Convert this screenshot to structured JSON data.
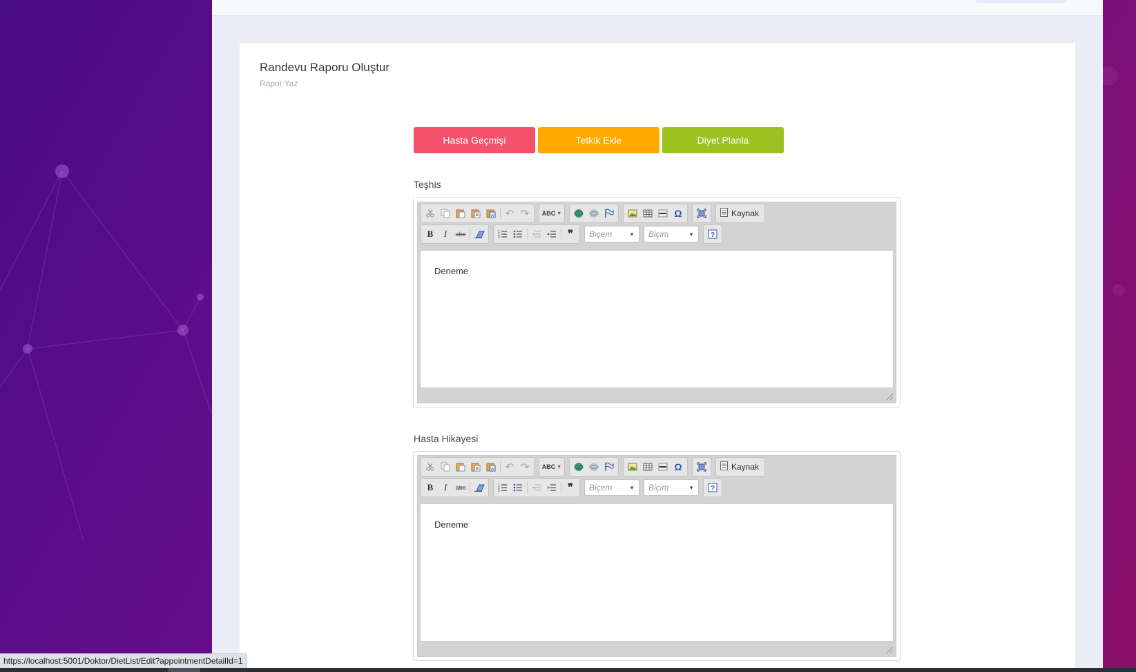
{
  "page": {
    "title": "Randevu Raporu Oluştur",
    "subtitle": "Rapor Yaz"
  },
  "actions": {
    "history_label": "Hasta Geçmişi",
    "test_label": "Tetkik Ekle",
    "diet_label": "Diyet Planla",
    "colors": {
      "history": "#f4516c",
      "test": "#ffa800",
      "diet": "#9bc220"
    }
  },
  "editors": [
    {
      "label": "Teşhis",
      "content": "Deneme",
      "source_label": "Kaynak",
      "style_combo": "Biçem",
      "format_combo": "Biçim"
    },
    {
      "label": "Hasta Hikayesi",
      "content": "Deneme",
      "source_label": "Kaynak",
      "style_combo": "Biçem",
      "format_combo": "Biçim"
    }
  ],
  "toolbar_icons": {
    "row1": [
      "cut-icon",
      "copy-icon",
      "paste-icon",
      "paste-text-icon",
      "paste-word-icon",
      "undo-icon",
      "redo-icon",
      "spellcheck-icon",
      "link-icon",
      "unlink-icon",
      "anchor-icon",
      "image-icon",
      "table-icon",
      "horizontal-rule-icon",
      "special-char-icon",
      "maximize-icon",
      "source-icon"
    ],
    "row2": [
      "bold-icon",
      "italic-icon",
      "strike-icon",
      "remove-format-icon",
      "numbered-list-icon",
      "bulleted-list-icon",
      "outdent-icon",
      "indent-icon",
      "blockquote-icon",
      "help-icon"
    ]
  },
  "status_bar": {
    "url": "https://localhost:5001/Doktor/DietList/Edit?appointmentDetailId=1"
  }
}
